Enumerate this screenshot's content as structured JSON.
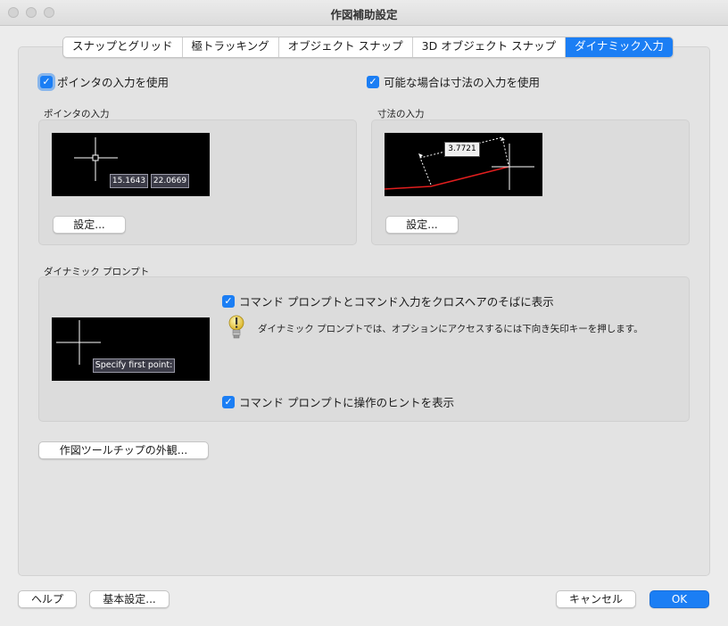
{
  "window": {
    "title": "作図補助設定"
  },
  "tabs": [
    {
      "label": "スナップとグリッド",
      "active": false
    },
    {
      "label": "極トラッキング",
      "active": false
    },
    {
      "label": "オブジェクト スナップ",
      "active": false
    },
    {
      "label": "3D オブジェクト スナップ",
      "active": false
    },
    {
      "label": "ダイナミック入力",
      "active": true
    }
  ],
  "options": {
    "pointer_input": {
      "label": "ポインタの入力を使用",
      "checked": true
    },
    "dimension_input": {
      "label": "可能な場合は寸法の入力を使用",
      "checked": true
    }
  },
  "pointer_group": {
    "title": "ポインタの入力",
    "coord_x": "15.1643",
    "coord_y": "22.0669",
    "settings_button": "設定..."
  },
  "dimension_group": {
    "title": "寸法の入力",
    "value": "3.7721",
    "settings_button": "設定..."
  },
  "prompt_group": {
    "title": "ダイナミック プロンプト",
    "show_near_crosshair": {
      "label": "コマンド プロンプトとコマンド入力をクロスヘアのそばに表示",
      "checked": true
    },
    "tip": "ダイナミック プロンプトでは、オプションにアクセスするには下向き矢印キーを押します。",
    "preview_text": "Specify first point:",
    "show_hints": {
      "label": "コマンド プロンプトに操作のヒントを表示",
      "checked": true
    }
  },
  "tooltip_appearance_button": "作図ツールチップの外観...",
  "footer": {
    "help": "ヘルプ",
    "preferences": "基本設定...",
    "cancel": "キャンセル",
    "ok": "OK"
  },
  "colors": {
    "accent": "#1b7ef4",
    "preview_bg": "#000000",
    "red_line": "#e11e1e"
  },
  "icons": {
    "check": "✓",
    "bulb": "lightbulb-icon"
  }
}
